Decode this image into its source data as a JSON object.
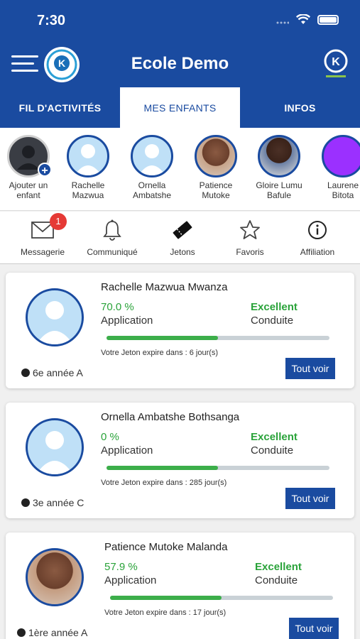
{
  "status": {
    "time": "7:30"
  },
  "header": {
    "title": "Ecole Demo"
  },
  "tabs": [
    {
      "label": "FIL D'ACTIVITÉS",
      "active": false
    },
    {
      "label": "MES ENFANTS",
      "active": true
    },
    {
      "label": "INFOS",
      "active": false
    }
  ],
  "children": [
    {
      "line1": "Ajouter un",
      "line2": "enfant"
    },
    {
      "line1": "Rachelle",
      "line2": "Mazwua"
    },
    {
      "line1": "Ornella",
      "line2": "Ambatshe"
    },
    {
      "line1": "Patience",
      "line2": "Mutoke"
    },
    {
      "line1": "Gloire Lumu",
      "line2": "Bafule"
    },
    {
      "line1": "Laurene",
      "line2": "Bitota"
    }
  ],
  "shortcuts": {
    "messagerie": {
      "label": "Messagerie",
      "badge": "1"
    },
    "communique": {
      "label": "Communiqué"
    },
    "jetons": {
      "label": "Jetons"
    },
    "favoris": {
      "label": "Favoris"
    },
    "affiliation": {
      "label": "Affiliation"
    }
  },
  "cards": [
    {
      "name": "Rachelle Mazwua Mwanza",
      "percent": "70.0 %",
      "progress": 0.5,
      "application": "Application",
      "grade": "Excellent",
      "conduct": "Conduite",
      "expiry": "Votre Jeton expire dans : 6 jour(s)",
      "class": "6e année A",
      "button": "Tout voir"
    },
    {
      "name": "Ornella Ambatshe Bothsanga",
      "percent": "0 %",
      "progress": 0.5,
      "application": "Application",
      "grade": "Excellent",
      "conduct": "Conduite",
      "expiry": "Votre Jeton expire dans : 285 jour(s)",
      "class": "3e année C",
      "button": "Tout voir"
    },
    {
      "name": "Patience Mutoke Malanda",
      "percent": "57.9 %",
      "progress": 0.5,
      "application": "Application",
      "grade": "Excellent",
      "conduct": "Conduite",
      "expiry": "Votre Jeton expire dans : 17 jour(s)",
      "class": "1ère année A",
      "button": "Tout voir"
    }
  ],
  "colors": {
    "primary": "#1a4ba0",
    "success": "#2aa33a",
    "badge": "#e53935"
  }
}
